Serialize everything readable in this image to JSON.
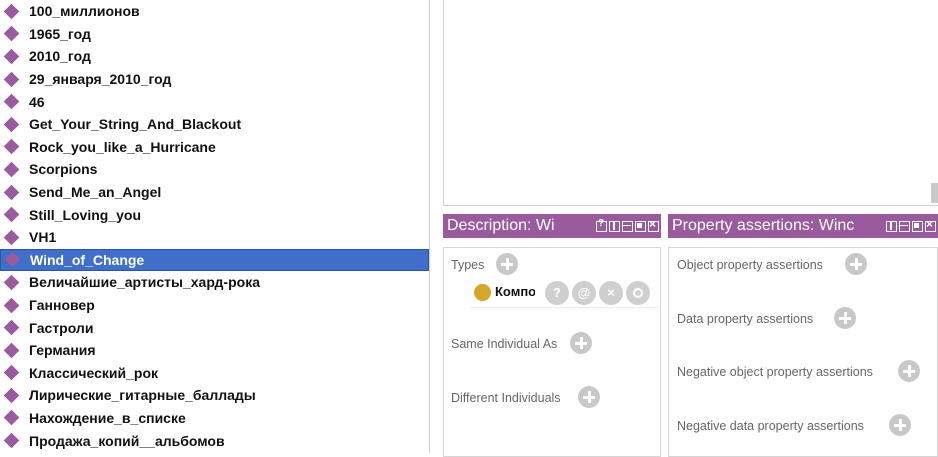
{
  "individuals": [
    {
      "label": "100_миллионов",
      "selected": false
    },
    {
      "label": "1965_год",
      "selected": false
    },
    {
      "label": "2010_год",
      "selected": false
    },
    {
      "label": "29_января_2010_год",
      "selected": false
    },
    {
      "label": "46",
      "selected": false
    },
    {
      "label": "Get_Your_String_And_Blackout",
      "selected": false
    },
    {
      "label": "Rock_you_like_a_Hurricane",
      "selected": false
    },
    {
      "label": "Scorpions",
      "selected": false
    },
    {
      "label": "Send_Me_an_Angel",
      "selected": false
    },
    {
      "label": "Still_Loving_you",
      "selected": false
    },
    {
      "label": "VH1",
      "selected": false
    },
    {
      "label": "Wind_of_Change",
      "selected": true
    },
    {
      "label": "Величайшие_артисты_хард-рока",
      "selected": false
    },
    {
      "label": "Ганновер",
      "selected": false
    },
    {
      "label": "Гастроли",
      "selected": false
    },
    {
      "label": "Германия",
      "selected": false
    },
    {
      "label": "Классический_рок",
      "selected": false
    },
    {
      "label": "Лирические_гитарные_баллады",
      "selected": false
    },
    {
      "label": "Нахождение_в_списке",
      "selected": false
    },
    {
      "label": "Продажа_копий__альбомов",
      "selected": false
    }
  ],
  "description_panel": {
    "title": "Description: Wi",
    "types_label": "Types",
    "type_value": "Композ",
    "same_individual_label": "Same Individual As",
    "different_individuals_label": "Different Individuals"
  },
  "property_panel": {
    "title": "Property assertions: Winc",
    "object_property_label": "Object property assertions",
    "data_property_label": "Data property assertions",
    "negative_object_label": "Negative object property assertions",
    "negative_data_label": "Negative data property assertions"
  },
  "type_buttons": {
    "help": "?",
    "annotate": "@",
    "delete": "×"
  },
  "colors": {
    "accent": "#9a5a9e",
    "selection": "#3f6fc8",
    "class_dot": "#d4a62a",
    "button_gray": "#c8c8c8"
  },
  "icons": {
    "individual": "diamond-icon",
    "add": "plus-circle-icon",
    "class": "class-circle-icon"
  }
}
